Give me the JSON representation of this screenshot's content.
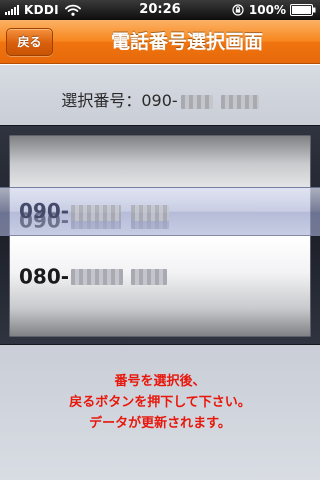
{
  "status_bar": {
    "carrier": "KDDI",
    "time": "20:26",
    "battery": "100%",
    "icons": [
      "signal-icon",
      "wifi-icon",
      "orientation-lock-icon",
      "battery-icon"
    ]
  },
  "nav": {
    "back_label": "戻る",
    "title": "電話番号選択画面"
  },
  "selection": {
    "label": "選択番号：",
    "value_prefix": "090-"
  },
  "picker": {
    "rows": [
      {
        "prefix": "090-"
      },
      {
        "prefix": "080-"
      }
    ],
    "selected_index": 0
  },
  "instructions": [
    "番号を選択後、",
    "戻るボタンを押下して下さい。",
    "データが更新されます。"
  ],
  "colors": {
    "nav_orange": "#f07410",
    "instruction_red": "#e8170c",
    "background_gray": "#cfd3da"
  }
}
